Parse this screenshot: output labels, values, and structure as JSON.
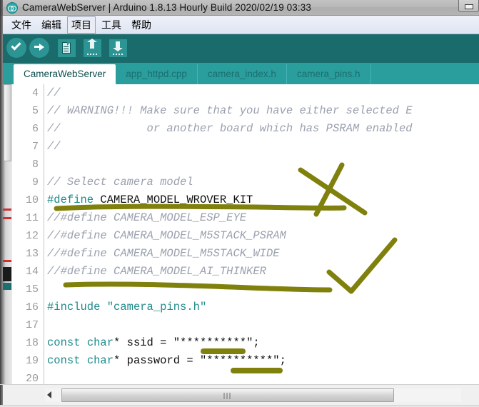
{
  "window": {
    "title": "CameraWebServer | Arduino 1.8.13 Hourly Build 2020/02/19 03:33",
    "logo_icon": "arduino-logo-icon",
    "minimize_label": ""
  },
  "menubar": {
    "items": [
      {
        "label": "文件",
        "active": false
      },
      {
        "label": "编辑",
        "active": false
      },
      {
        "label": "项目",
        "active": true
      },
      {
        "label": "工具",
        "active": false
      },
      {
        "label": "帮助",
        "active": false
      }
    ]
  },
  "toolbar": {
    "buttons": [
      {
        "name": "verify-button",
        "icon": "check-circle-icon"
      },
      {
        "name": "upload-button",
        "icon": "arrow-right-circle-icon"
      },
      {
        "name": "new-button",
        "icon": "new-file-icon"
      },
      {
        "name": "open-button",
        "icon": "arrow-up-icon"
      },
      {
        "name": "save-button",
        "icon": "arrow-down-icon"
      }
    ]
  },
  "tabs": [
    {
      "label": "CameraWebServer",
      "active": true
    },
    {
      "label": "app_httpd.cpp",
      "active": false
    },
    {
      "label": "camera_index.h",
      "active": false
    },
    {
      "label": "camera_pins.h",
      "active": false
    }
  ],
  "editor": {
    "first_line_number": 4,
    "lines": [
      {
        "num": "4",
        "tokens": [
          {
            "t": "//",
            "c": "cmt"
          }
        ]
      },
      {
        "num": "5",
        "tokens": [
          {
            "t": "// WARNING!!! Make sure that you have either selected E",
            "c": "cmt"
          }
        ]
      },
      {
        "num": "6",
        "tokens": [
          {
            "t": "//             or another board which has PSRAM enabled",
            "c": "cmt"
          }
        ]
      },
      {
        "num": "7",
        "tokens": [
          {
            "t": "//",
            "c": "cmt"
          }
        ]
      },
      {
        "num": "8",
        "tokens": [
          {
            "t": "",
            "c": "plain"
          }
        ]
      },
      {
        "num": "9",
        "tokens": [
          {
            "t": "// Select camera model",
            "c": "cmt"
          }
        ]
      },
      {
        "num": "10",
        "tokens": [
          {
            "t": "#define",
            "c": "kw"
          },
          {
            "t": " CAMERA_MODEL_WROVER_KIT",
            "c": "plain"
          }
        ]
      },
      {
        "num": "11",
        "tokens": [
          {
            "t": "//#define CAMERA_MODEL_ESP_EYE",
            "c": "cmt"
          }
        ]
      },
      {
        "num": "12",
        "tokens": [
          {
            "t": "//#define CAMERA_MODEL_M5STACK_PSRAM",
            "c": "cmt"
          }
        ]
      },
      {
        "num": "13",
        "tokens": [
          {
            "t": "//#define CAMERA_MODEL_M5STACK_WIDE",
            "c": "cmt"
          }
        ]
      },
      {
        "num": "14",
        "tokens": [
          {
            "t": "//#define CAMERA_MODEL_AI_THINKER",
            "c": "cmt"
          }
        ]
      },
      {
        "num": "15",
        "tokens": [
          {
            "t": "",
            "c": "plain"
          }
        ]
      },
      {
        "num": "16",
        "tokens": [
          {
            "t": "#include",
            "c": "kw"
          },
          {
            "t": " ",
            "c": "plain"
          },
          {
            "t": "\"camera_pins.h\"",
            "c": "str"
          }
        ]
      },
      {
        "num": "17",
        "tokens": [
          {
            "t": "",
            "c": "plain"
          }
        ]
      },
      {
        "num": "18",
        "tokens": [
          {
            "t": "const",
            "c": "kw"
          },
          {
            "t": " ",
            "c": "plain"
          },
          {
            "t": "char",
            "c": "kw"
          },
          {
            "t": "* ssid = \"**********\";",
            "c": "plain"
          }
        ]
      },
      {
        "num": "19",
        "tokens": [
          {
            "t": "const",
            "c": "kw"
          },
          {
            "t": " ",
            "c": "plain"
          },
          {
            "t": "char",
            "c": "kw"
          },
          {
            "t": "* password = \"**********\";",
            "c": "plain"
          }
        ]
      },
      {
        "num": "20",
        "tokens": [
          {
            "t": "",
            "c": "plain"
          }
        ]
      }
    ]
  },
  "annotations": {
    "ink_color": "#80800d",
    "marks": [
      {
        "name": "annotation-underline-line10",
        "type": "underline"
      },
      {
        "name": "annotation-cross-mark",
        "type": "x-mark"
      },
      {
        "name": "annotation-underline-line14",
        "type": "underline"
      },
      {
        "name": "annotation-check-mark",
        "type": "check-mark"
      },
      {
        "name": "annotation-underline-ssid",
        "type": "underline"
      },
      {
        "name": "annotation-underline-password",
        "type": "underline"
      }
    ]
  },
  "scrollbars": {
    "horizontal_grip": "grip-icon",
    "left_arrow": "arrow-left-icon"
  },
  "colors": {
    "toolbar_bg": "#1a6b6b",
    "tab_bg": "#2a9d9d",
    "keyword": "#1f8b8b",
    "comment": "#9aa0ae",
    "ink": "#80800d"
  }
}
